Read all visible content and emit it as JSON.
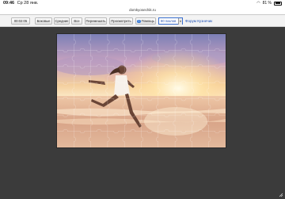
{
  "status_bar": {
    "time": "09:46",
    "date": "Ср 28 янв.",
    "battery_text": "81 %",
    "battery_level": 0.81
  },
  "browser": {
    "url": "domkyosechik.ru"
  },
  "toolbar": {
    "timer": "00:02:05",
    "easy": "Боковые",
    "medium": "Средние",
    "all": "Все",
    "shuffle": "Перемешать",
    "preview": "Просмотреть",
    "help": "Помощь",
    "pieces_select": "80 пазлов",
    "forum_link": "Форум Кузнечик"
  },
  "puzzle": {
    "description": "",
    "grid_cols": 10,
    "grid_rows": 7
  },
  "colors": {
    "page_bg": "#3b3b3b",
    "toolbar_bg": "#f3f3f3",
    "link": "#1f53b8",
    "select_border": "#3a6fd0"
  }
}
